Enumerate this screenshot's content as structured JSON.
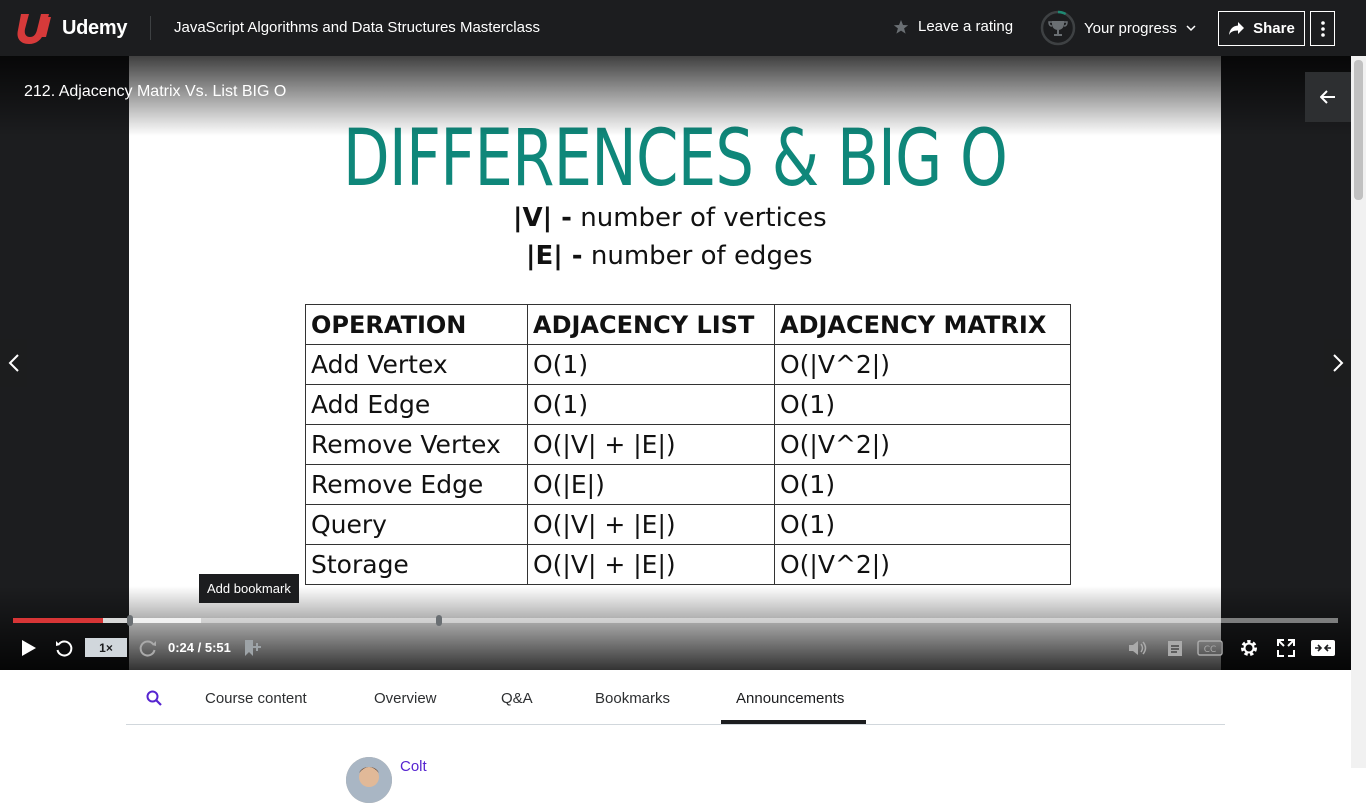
{
  "header": {
    "brand": "Udemy",
    "course_title": "JavaScript Algorithms and Data Structures Masterclass",
    "rating_label": "Leave a rating",
    "progress_label": "Your progress",
    "share_label": "Share"
  },
  "player": {
    "lecture_title": "212. Adjacency Matrix Vs. List BIG O",
    "tooltip": "Add bookmark",
    "playback_rate": "1×",
    "timecode": "0:24 / 5:51",
    "progress_fraction": 0.068
  },
  "slide": {
    "heading": "DIFFERENCES & BIG O",
    "definitions": [
      {
        "symbol": "|V| -",
        "text": " number of vertices"
      },
      {
        "symbol": "|E| -",
        "text": " number of edges"
      }
    ],
    "table": {
      "headers": [
        "OPERATION",
        "ADJACENCY LIST",
        "ADJACENCY MATRIX"
      ],
      "rows": [
        [
          "Add Vertex",
          "O(1)",
          "O(|V^2|)"
        ],
        [
          "Add Edge",
          "O(1)",
          "O(1)"
        ],
        [
          "Remove Vertex",
          "O(|V| + |E|)",
          "O(|V^2|)"
        ],
        [
          "Remove Edge",
          "O(|E|)",
          "O(1)"
        ],
        [
          "Query",
          "O(|V| + |E|)",
          "O(1)"
        ],
        [
          "Storage",
          "O(|V| + |E|)",
          "O(|V^2|)"
        ]
      ]
    }
  },
  "tabs": {
    "items": [
      "Course content",
      "Overview",
      "Q&A",
      "Bookmarks",
      "Announcements"
    ],
    "active": "Announcements"
  },
  "announcement": {
    "author": "Colt"
  },
  "colors": {
    "brand_red": "#a435f0",
    "heading_teal": "#0f877a",
    "progress_red": "#d73536"
  }
}
